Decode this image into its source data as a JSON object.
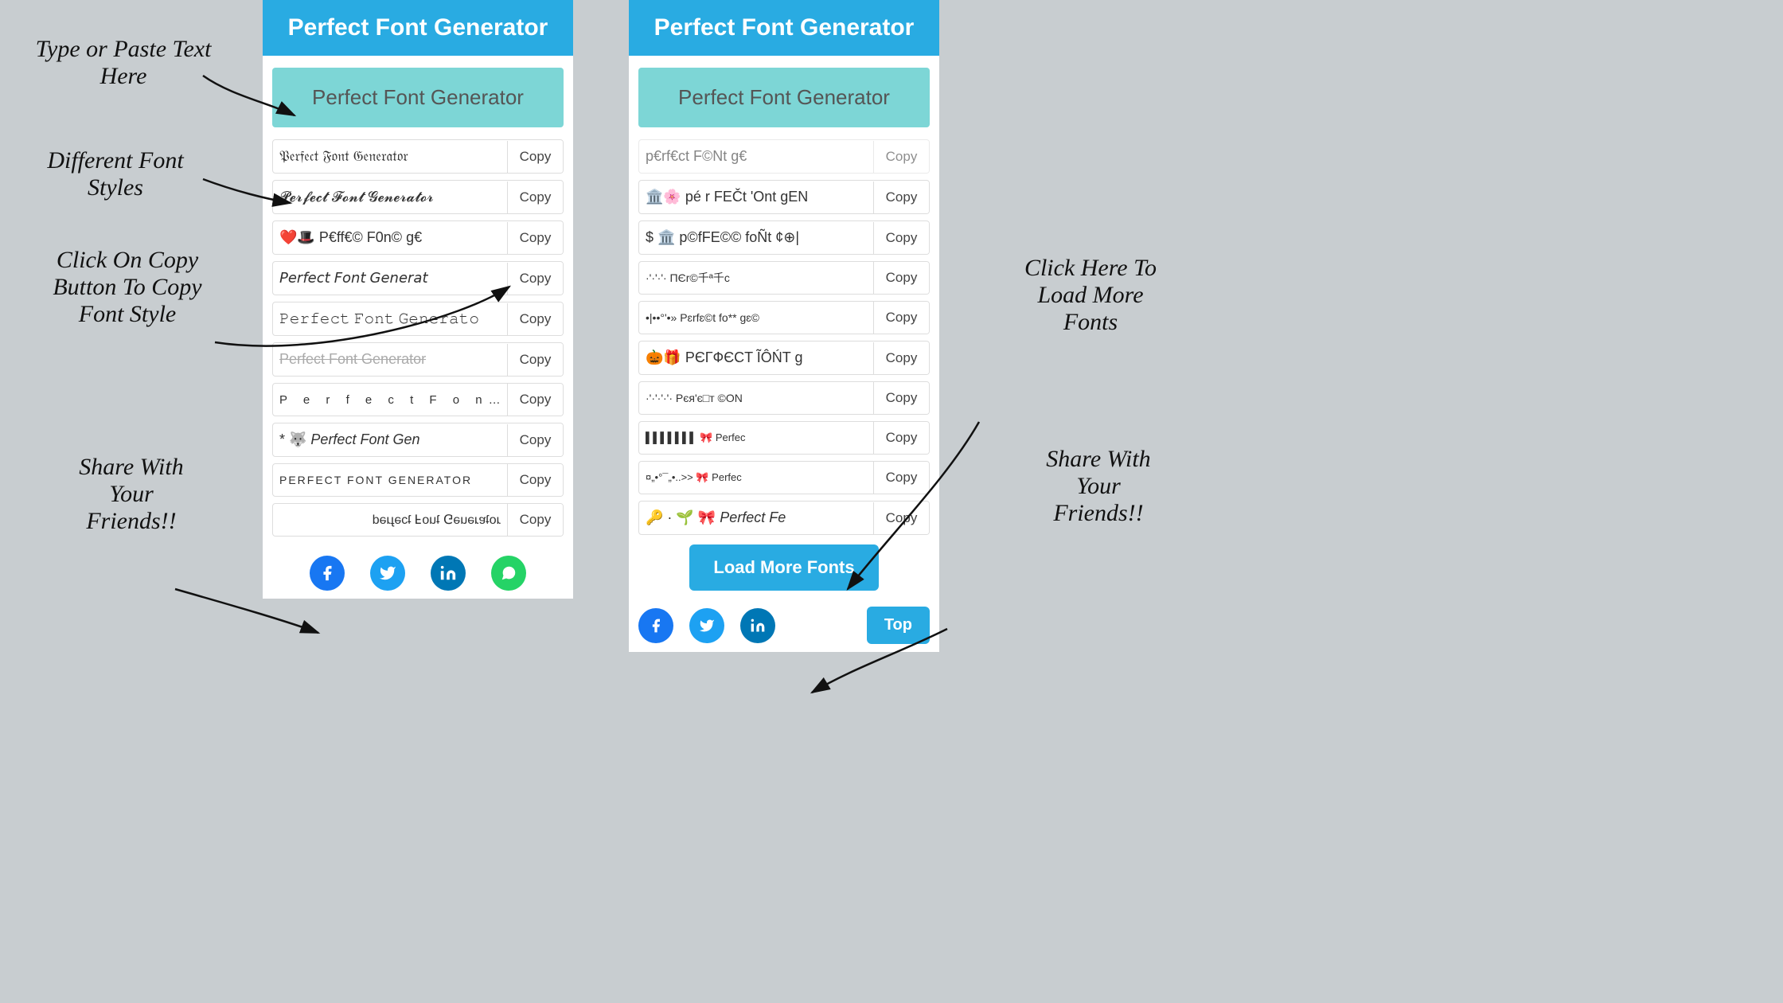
{
  "app": {
    "title": "Perfect Font Generator",
    "input_placeholder": "Perfect Font Generator",
    "header": "Perfect Font Generator"
  },
  "annotations": {
    "type_paste": "Type or Paste Text\nHere",
    "different_fonts": "Different Font\nStyles",
    "click_copy": "Click On Copy\nButton To Copy\nFont Style",
    "share_left": "Share With\nYour\nFriends!!",
    "click_load": "Click Here To\nLoad More\nFonts",
    "share_right": "Share With\nYour\nFriends!!"
  },
  "left_panel": {
    "fonts": [
      {
        "text": "𝔓𝔢𝔯𝔣𝔢𝔠𝔱 𝔉𝔬𝔫𝔱 𝔊𝔢𝔫𝔢𝔯𝔞𝔱𝔬𝔯",
        "style": "fraktur"
      },
      {
        "text": "𝓟𝓮𝓻𝓯𝓮𝓬𝓽 𝓕𝓸𝓷𝓽 𝓖𝓮𝓷𝓮𝓻𝓪𝓽𝓸𝓻",
        "style": "script"
      },
      {
        "text": "❤️🎩 P€ff€© F0n© g€",
        "style": "emoji"
      },
      {
        "text": "𝘗𝘦𝘳𝘧𝘦𝘤𝘵 𝘍𝘰𝘯𝘵 𝘎𝘦𝘯𝘦𝘳𝘢𝘵",
        "style": "italic-sans"
      },
      {
        "text": "𝙿𝚎𝚛𝚏𝚎𝚌𝚝 𝙵𝚘𝚗𝚝 𝙶𝚎𝚗𝚎𝚛𝚊𝚝𝚘",
        "style": "mono"
      },
      {
        "text": "Perfect Font Generator",
        "style": "strikethrough"
      },
      {
        "text": "P  e  r  f  e  c  t   F  o  n  t",
        "style": "spaced"
      },
      {
        "text": "* 🐺 Perfect Font Gen",
        "style": "emoji2"
      },
      {
        "text": "PERFECT FONT GENERATOR",
        "style": "uppercase"
      },
      {
        "text": "ɹoʇɐɹǝuǝ⅁ ʇuoℲ ʇɔǝɟɹǝd",
        "style": "flipped"
      }
    ],
    "copy_label": "Copy"
  },
  "right_panel": {
    "partial_top": "p€rf€ct F©Nt g€",
    "fonts": [
      {
        "text": "🏛️🌸 pé r FEČt 'Ont gEN",
        "style": "emoji"
      },
      {
        "text": "$ 🏛️ p©fFE©© foÑt ¢⊕|",
        "style": "emoji2"
      },
      {
        "text": "·'·'·'·  ΠЄr©千ª千c",
        "style": "dots"
      },
      {
        "text": "•|••°'•»  Pɛrfɛ©t fo** gɛ©",
        "style": "dots2"
      },
      {
        "text": "🎃🎁 ΡЄГФЄCT ĨÔŃT g",
        "style": "emoji3"
      },
      {
        "text": "·'·'·'·'·  Рєя'є□т ©ON",
        "style": "dots3"
      },
      {
        "text": "▌▌▌▌▌▌▌  🎀 Perfec",
        "style": "bars"
      },
      {
        "text": "¤„•°¯„•..>> 🎀 Perfec",
        "style": "dots4"
      },
      {
        "text": "🔑 · 🌱 🎀 Perfect Fe",
        "style": "emoji4"
      }
    ],
    "load_more": "Load More Fonts",
    "top_btn": "Top",
    "copy_label": "Copy"
  },
  "social": {
    "fb": "f",
    "tw": "🐦",
    "li": "in",
    "wa": "✆"
  },
  "colors": {
    "header_bg": "#29abe2",
    "input_bg": "#7dd6d6",
    "load_more_bg": "#29abe2",
    "top_bg": "#29abe2"
  }
}
